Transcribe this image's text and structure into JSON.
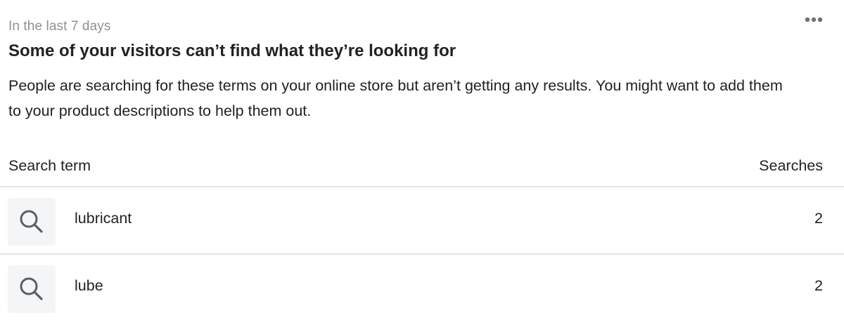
{
  "card": {
    "period_label": "In the last 7 days",
    "title": "Some of your visitors can’t find what they’re looking for",
    "description": "People are searching for these terms on your online store but aren’t getting any results. You might want to add them to your product descriptions to help them out.",
    "more_icon": "ellipsis-icon"
  },
  "table": {
    "columns": [
      "Search term",
      "Searches"
    ],
    "rows": [
      {
        "icon": "search-icon",
        "term": "lubricant",
        "searches": "2"
      },
      {
        "icon": "search-icon",
        "term": "lube",
        "searches": "2"
      }
    ]
  },
  "colors": {
    "text": "#202223",
    "subdued": "#8c9196",
    "divider": "#e1e3e5",
    "thumb_bg": "#f4f5f6",
    "icon": "#5c5f62"
  }
}
